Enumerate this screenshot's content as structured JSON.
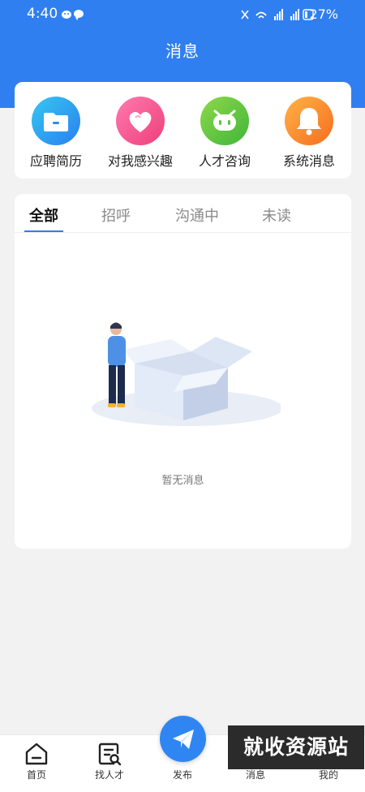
{
  "status_bar": {
    "time": "4:40",
    "battery_text": "27%"
  },
  "header": {
    "title": "消息"
  },
  "categories": [
    {
      "label": "应聘简历",
      "icon": "folder-icon",
      "color": "#2b8cf0"
    },
    {
      "label": "对我感兴趣",
      "icon": "heart-icon",
      "color": "#f2558c"
    },
    {
      "label": "人才咨询",
      "icon": "chat-bot-icon",
      "color": "#5cc43f"
    },
    {
      "label": "系统消息",
      "icon": "bell-icon",
      "color": "#fa7e22"
    }
  ],
  "tabs": [
    {
      "label": "全部",
      "active": true
    },
    {
      "label": "招呼",
      "active": false
    },
    {
      "label": "沟通中",
      "active": false
    },
    {
      "label": "未读",
      "active": false
    }
  ],
  "empty_state": {
    "text": "暂无消息"
  },
  "bottom_nav": [
    {
      "label": "首页",
      "icon": "home-icon"
    },
    {
      "label": "找人才",
      "icon": "search-doc-icon"
    },
    {
      "label": "发布",
      "icon": "paper-plane-icon"
    },
    {
      "label": "消息",
      "icon": "message-icon"
    },
    {
      "label": "我的",
      "icon": "profile-icon"
    }
  ],
  "watermark": {
    "text": "就收资源站"
  },
  "colors": {
    "primary": "#2f7ff0",
    "background": "#f2f2f2"
  }
}
